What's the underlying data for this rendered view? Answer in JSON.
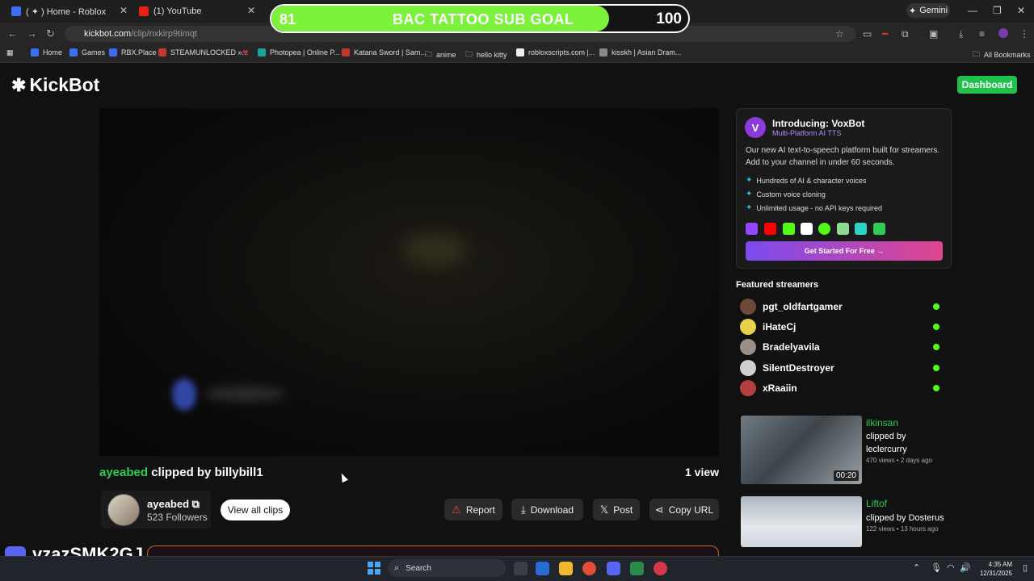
{
  "browser": {
    "tabs": [
      {
        "label": "( ✦ ) Home - Roblox",
        "favicon_color": "#3b6ef5"
      },
      {
        "label": "(1) YouTube",
        "favicon_color": "#e62117"
      }
    ],
    "gemini_label": "Gemini",
    "url": {
      "domain": "kickbot.com",
      "path": "/clip/nxkirp9timqt"
    },
    "bookmarks": [
      {
        "label": "Home",
        "color": "#3b6ef5"
      },
      {
        "label": "Games",
        "color": "#3b6ef5"
      },
      {
        "label": "RBX.Place",
        "color": "#3b6ef5"
      },
      {
        "label": "STEAMUNLOCKED »...",
        "color": "#c0392b"
      },
      {
        "label": "Photopea | Online P...",
        "color": "#18a497"
      },
      {
        "label": "Katana Sword | Sam...",
        "color": "#c0392b"
      },
      {
        "label": "anime",
        "color": "folder"
      },
      {
        "label": "hello kitty",
        "color": "folder"
      },
      {
        "label": "robloxscripts.com |...",
        "color": "#eeeeee"
      },
      {
        "label": "kisskh | Asian Dram...",
        "color": "#888888"
      }
    ],
    "all_bookmarks": "All Bookmarks"
  },
  "goal_overlay": {
    "start": "81",
    "title": "BAC TATTOO SUB GOAL",
    "end": "100",
    "progress_fraction": 0.81
  },
  "site": {
    "logo": "KickBot",
    "dashboard_label": "Dashboard"
  },
  "clip": {
    "streamer": "ayeabed",
    "clipped_by_text": "clipped by billybill1",
    "views": "1 view",
    "creator_name": "ayeabed",
    "creator_followers": "523 Followers",
    "view_all_label": "View all clips",
    "actions": {
      "report": "Report",
      "download": "Download",
      "post": "Post",
      "copy_url": "Copy URL"
    }
  },
  "overlay_username": "vzazSMK2GJ",
  "voxbot": {
    "title": "Introducing: VoxBot",
    "subtitle": "Multi-Platform AI TTS",
    "description": "Our new AI text-to-speech platform built for streamers. Add to your channel in under 60 seconds.",
    "features": [
      "Hundreds of AI & character voices",
      "Custom voice cloning",
      "Unlimited usage - no API keys required"
    ],
    "platform_colors": [
      "#9146ff",
      "#ff0000",
      "#53fc18",
      "#ffffff",
      "#53fc18",
      "#8fd88f",
      "#2bd4c4",
      "#2ecc55"
    ],
    "cta": "Get Started For Free →"
  },
  "featured": {
    "title": "Featured streamers",
    "streamers": [
      {
        "name": "pgt_oldfartgamer",
        "avatar_color": "#6b4a3a"
      },
      {
        "name": "iHateCj",
        "avatar_color": "#e8d24a"
      },
      {
        "name": "Bradelyavila",
        "avatar_color": "#9a8f86"
      },
      {
        "name": "SilentDestroyer",
        "avatar_color": "#cfcfcf"
      },
      {
        "name": "xRaaiin",
        "avatar_color": "#b34040"
      }
    ]
  },
  "related_clips": [
    {
      "streamer": "ilkinsan",
      "clipped_by": "clipped by leclercurry",
      "meta": "470 views • 2 days ago",
      "duration": "00:20"
    },
    {
      "streamer": "Liftof",
      "clipped_by": "clipped by Dosterus",
      "meta": "122 views • 13 hours ago",
      "duration": ""
    }
  ],
  "taskbar": {
    "search_placeholder": "Search",
    "time": "4:35 AM",
    "date": "12/31/2025"
  }
}
